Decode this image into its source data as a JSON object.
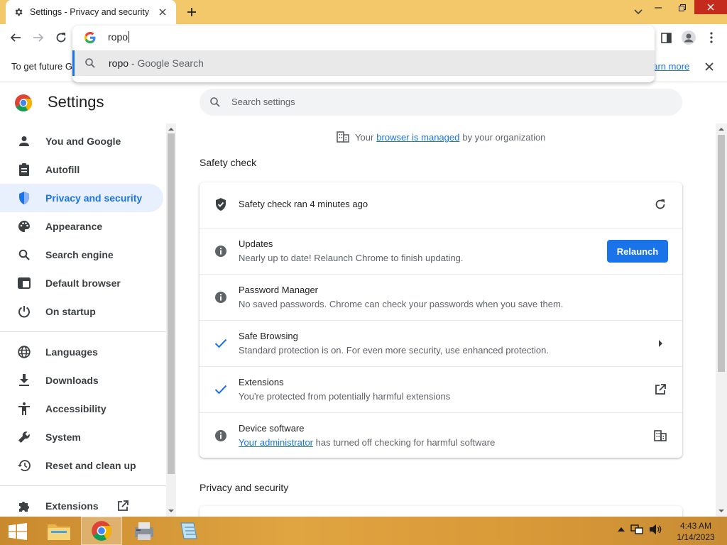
{
  "browser": {
    "tab_title": "Settings - Privacy and security",
    "omnibox_text": "ropo",
    "suggestion": {
      "query": "ropo",
      "suffix": " - Google Search"
    },
    "infobar_text": "To get future G",
    "infobar_link": "earn more"
  },
  "settings": {
    "title": "Settings",
    "search_placeholder": "Search settings",
    "managed": {
      "prefix": "Your",
      "link": "browser is managed",
      "suffix": "by your organization"
    },
    "sidebar": {
      "items": [
        {
          "label": "You and Google",
          "icon": "person-icon"
        },
        {
          "label": "Autofill",
          "icon": "clipboard-icon"
        },
        {
          "label": "Privacy and security",
          "icon": "shield-icon",
          "active": true
        },
        {
          "label": "Appearance",
          "icon": "palette-icon"
        },
        {
          "label": "Search engine",
          "icon": "search-icon"
        },
        {
          "label": "Default browser",
          "icon": "browser-icon"
        },
        {
          "label": "On startup",
          "icon": "power-icon"
        },
        {
          "label": "Languages",
          "icon": "globe-icon"
        },
        {
          "label": "Downloads",
          "icon": "download-icon"
        },
        {
          "label": "Accessibility",
          "icon": "accessibility-icon"
        },
        {
          "label": "System",
          "icon": "wrench-icon"
        },
        {
          "label": "Reset and clean up",
          "icon": "history-icon"
        },
        {
          "label": "Extensions",
          "icon": "puzzle-icon"
        }
      ]
    },
    "safety_check": {
      "heading": "Safety check",
      "status": "Safety check ran 4 minutes ago",
      "rows": [
        {
          "title": "Updates",
          "subtitle": "Nearly up to date! Relaunch Chrome to finish updating.",
          "button": "Relaunch"
        },
        {
          "title": "Password Manager",
          "subtitle": "No saved passwords. Chrome can check your passwords when you save them."
        },
        {
          "title": "Safe Browsing",
          "subtitle": "Standard protection is on. For even more security, use enhanced protection."
        },
        {
          "title": "Extensions",
          "subtitle": "You're protected from potentially harmful extensions"
        },
        {
          "title": "Device software",
          "subtitle_link": "Your administrator",
          "subtitle": "has turned off checking for harmful software"
        }
      ]
    },
    "privacy_heading": "Privacy and security"
  },
  "taskbar": {
    "time": "4:43 AM",
    "date": "1/14/2023"
  },
  "colors": {
    "accent": "#1a73e8",
    "titlebar": "#f2c86a",
    "close": "#c42b1c"
  }
}
